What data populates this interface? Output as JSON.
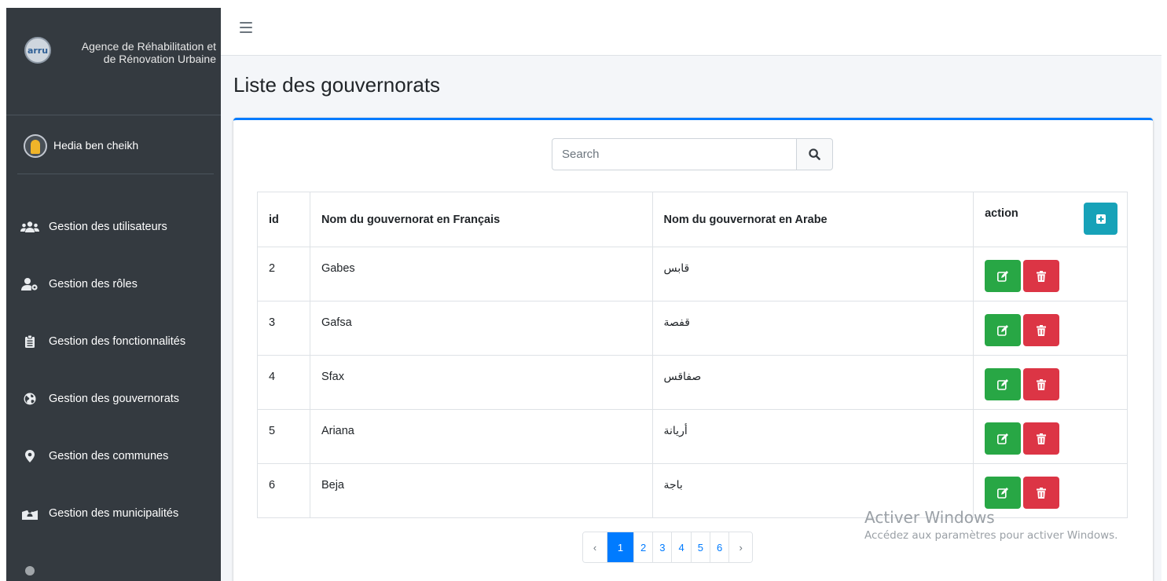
{
  "sidebar": {
    "brand_logo": "arru",
    "brand_title": "Agence de Réhabilitation et de Rénovation Urbaine",
    "user_name": "Hedia ben cheikh",
    "items": [
      {
        "label": "Gestion des utilisateurs",
        "icon": "users-icon"
      },
      {
        "label": "Gestion des rôles",
        "icon": "user-cog-icon"
      },
      {
        "label": "Gestion des fonctionnalités",
        "icon": "clipboard-list-icon"
      },
      {
        "label": "Gestion des gouvernorats",
        "icon": "globe-icon"
      },
      {
        "label": "Gestion des communes",
        "icon": "map-marker-icon"
      },
      {
        "label": "Gestion des municipalités",
        "icon": "map-people-icon"
      }
    ]
  },
  "page": {
    "title": "Liste des gouvernorats"
  },
  "search": {
    "placeholder": "Search"
  },
  "table": {
    "headers": {
      "id": "id",
      "name_fr": "Nom du gouvernorat en Français",
      "name_ar": "Nom du gouvernorat en Arabe",
      "action": "action"
    },
    "rows": [
      {
        "id": "2",
        "name_fr": "Gabes",
        "name_ar": "قابس"
      },
      {
        "id": "3",
        "name_fr": "Gafsa",
        "name_ar": "قفصة"
      },
      {
        "id": "4",
        "name_fr": "Sfax",
        "name_ar": "صفاقس"
      },
      {
        "id": "5",
        "name_fr": "Ariana",
        "name_ar": "أريانة"
      },
      {
        "id": "6",
        "name_fr": "Beja",
        "name_ar": "باجة"
      }
    ]
  },
  "pagination": {
    "prev": "‹",
    "pages": [
      "1",
      "2",
      "3",
      "4",
      "5",
      "6"
    ],
    "active": "1",
    "next": "›"
  },
  "watermark": {
    "title": "Activer Windows",
    "subtitle": "Accédez aux paramètres pour activer Windows."
  },
  "colors": {
    "sidebar_bg": "#343a40",
    "primary": "#007bff",
    "info": "#17a2b8",
    "success": "#28a745",
    "danger": "#dc3545"
  }
}
